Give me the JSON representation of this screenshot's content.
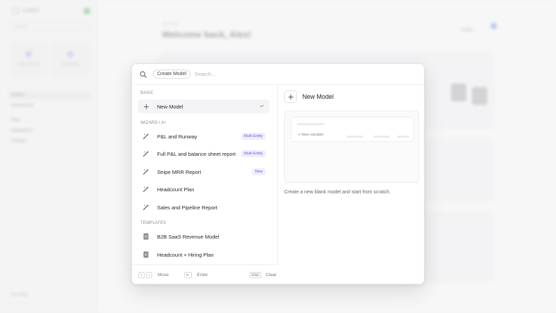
{
  "background": {
    "sidebar_title": "Untitled",
    "sidebar_search": "Search",
    "tile_a": "New model",
    "tile_b": "Templates",
    "nav": [
      "Models",
      "Dashboards",
      "Data",
      "Integrations",
      "Settings"
    ],
    "footer": "Get Help",
    "subheading": "Overview",
    "welcome": "Welcome back, Alex!",
    "top_button": "Invite"
  },
  "search": {
    "chip_label": "Create Model",
    "placeholder": "Search..."
  },
  "sections": {
    "basic": "BASIC",
    "wizard": "WIZARD / AI",
    "templates": "TEMPLATES"
  },
  "basic_items": [
    {
      "label": "New Model",
      "icon": "plus-icon",
      "shortcut": "↵"
    }
  ],
  "wizard_items": [
    {
      "label": "P&L and Runway",
      "icon": "magic-wand-icon",
      "tag": "Multi Entity"
    },
    {
      "label": "Full P&L and balance sheet report",
      "icon": "magic-wand-icon",
      "tag": "Multi Entity"
    },
    {
      "label": "Stripe MRR Report",
      "icon": "magic-wand-icon",
      "tag": "New"
    },
    {
      "label": "Headcount Plan",
      "icon": "magic-wand-icon",
      "tag": ""
    },
    {
      "label": "Sales and Pipeline Report",
      "icon": "magic-wand-icon",
      "tag": ""
    }
  ],
  "template_items": [
    {
      "label": "B2B SaaS Revenue Model",
      "icon": "document-icon"
    },
    {
      "label": "Headcount + Hiring Plan",
      "icon": "document-icon"
    }
  ],
  "footer_hints": {
    "up_key": "↑",
    "down_key": "↓",
    "move": "Move",
    "enter_key": "↵",
    "enter": "Enter",
    "esc_key": "ESC",
    "clear": "Clear"
  },
  "preview": {
    "title": "New Model",
    "new_variable": "New variable",
    "description": "Create a new blank model and start from scratch."
  },
  "colors": {
    "accent": "#7458d8",
    "tag_bg": "#f0ecfd"
  }
}
